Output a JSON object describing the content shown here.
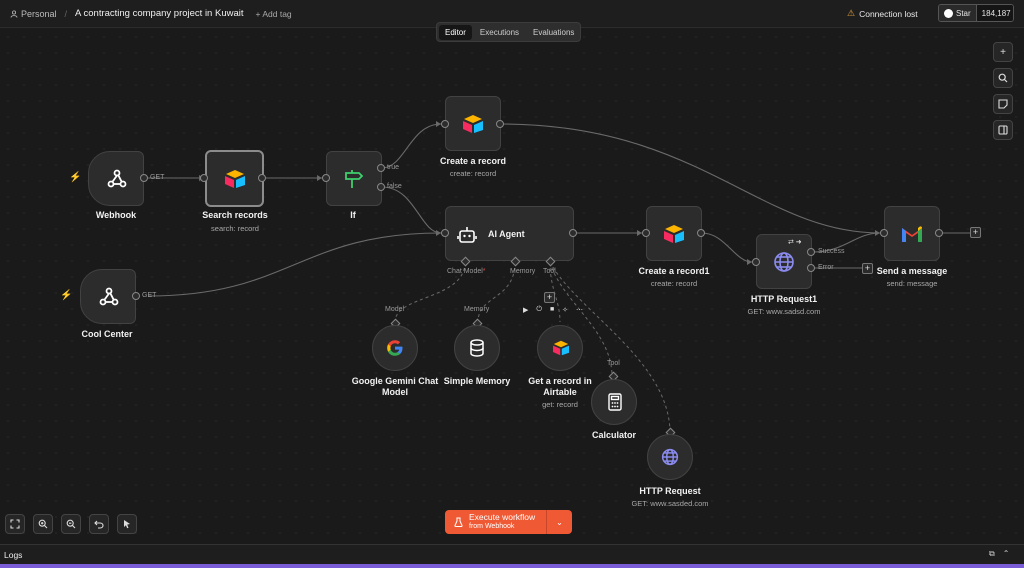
{
  "header": {
    "workspace": "Personal",
    "separator": "/",
    "project_title": "A contracting company project in Kuwait",
    "add_tag": "+ Add tag",
    "connection_status": "Connection lost",
    "github_star_label": "Star",
    "github_star_count": "184,187"
  },
  "tabs": [
    {
      "label": "Editor",
      "active": true
    },
    {
      "label": "Executions",
      "active": false
    },
    {
      "label": "Evaluations",
      "active": false
    }
  ],
  "nodes": {
    "webhook": {
      "label": "Webhook",
      "icon": "webhook-icon"
    },
    "search_records": {
      "label": "Search records",
      "sub": "search: record",
      "icon": "airtable-icon"
    },
    "if": {
      "label": "If",
      "icon": "signpost-icon",
      "true_label": "true",
      "false_label": "false"
    },
    "create_record": {
      "label": "Create a record",
      "sub": "create: record",
      "icon": "airtable-icon"
    },
    "ai_agent": {
      "label": "AI Agent",
      "icon": "robot-icon",
      "chat_model": "Chat Model",
      "chat_model_required": "*",
      "memory": "Memory",
      "tool": "Tool"
    },
    "cool_center": {
      "label": "Cool Center",
      "icon": "webhook-icon"
    },
    "create_record1": {
      "label": "Create a record1",
      "sub": "create: record",
      "icon": "airtable-icon"
    },
    "http_request1": {
      "label": "HTTP Request1",
      "sub": "GET: www.sadsd.com",
      "icon": "globe-icon",
      "success_label": "Success",
      "error_label": "Error"
    },
    "send_message": {
      "label": "Send a message",
      "sub": "send: message",
      "icon": "gmail-icon"
    },
    "gemini": {
      "label_line1": "Google Gemini Chat",
      "label_line2": "Model",
      "port_label": "Model",
      "icon": "google-icon"
    },
    "simple_memory": {
      "label": "Simple Memory",
      "port_label": "Memory",
      "icon": "database-icon"
    },
    "get_record": {
      "label_line1": "Get a record in",
      "label_line2": "Airtable",
      "sub": "get: record",
      "icon": "airtable-icon"
    },
    "calculator": {
      "label": "Calculator",
      "port_label": "Tool",
      "icon": "calculator-icon"
    },
    "http_request": {
      "label": "HTTP Request",
      "sub": "GET: www.sasded.com",
      "icon": "globe-icon"
    }
  },
  "edge_labels": {
    "webhook_get": "GET",
    "cool_center_get": "GET"
  },
  "execute": {
    "line1": "Execute workflow",
    "line2": "from Webhook"
  },
  "logs": {
    "label": "Logs"
  },
  "colors": {
    "accent_orange": "#ef5a35",
    "canvas_bg": "#1a1a1a",
    "node_bg": "#2c2c2c",
    "footer_accent": "#7a5cd6"
  }
}
